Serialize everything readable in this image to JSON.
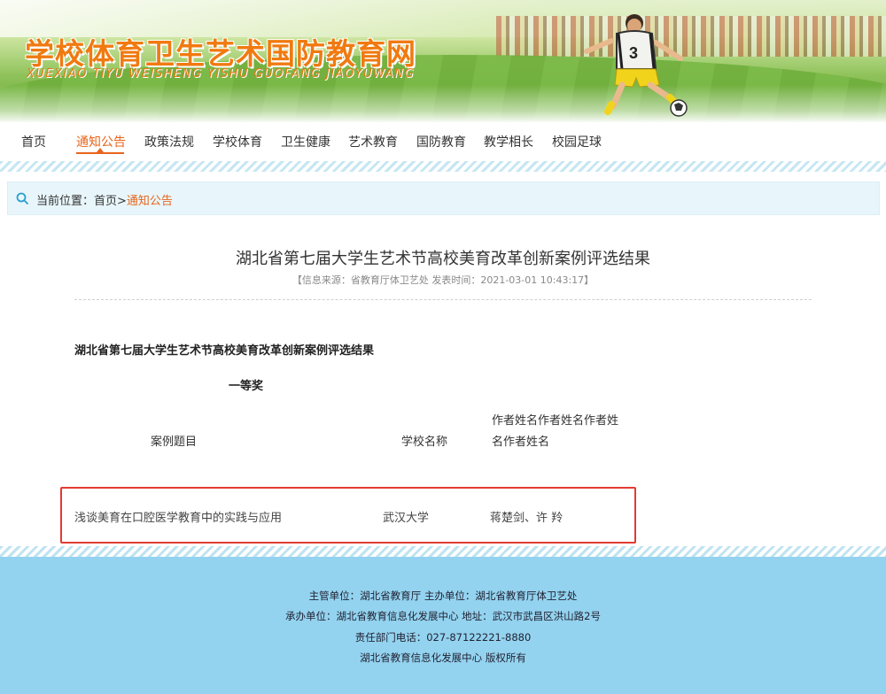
{
  "banner": {
    "title_cn": "学校体育卫生艺术国防教育网",
    "title_en": "XUEXIAO TIYU WEISHENG YISHU GUOFANG JIAOYUWANG",
    "jersey_number": "3"
  },
  "nav": {
    "items": [
      {
        "label": "首页"
      },
      {
        "label": "通知公告",
        "active": true
      },
      {
        "label": "政策法规"
      },
      {
        "label": "学校体育"
      },
      {
        "label": "卫生健康"
      },
      {
        "label": "艺术教育"
      },
      {
        "label": "国防教育"
      },
      {
        "label": "教学相长"
      },
      {
        "label": "校园足球"
      }
    ]
  },
  "breadcrumb": {
    "prefix": "当前位置：首页>",
    "current": "通知公告"
  },
  "article": {
    "title": "湖北省第七届大学生艺术节高校美育改革创新案例评选结果",
    "meta": "【信息来源：省教育厅体卫艺处 发表时间：2021-03-01 10:43:17】",
    "body_heading": "湖北省第七届大学生艺术节高校美育改革创新案例评选结果",
    "award": "一等奖",
    "table": {
      "headers": {
        "case": "案例题目",
        "school": "学校名称",
        "author": "作者姓名作者姓名作者姓名作者姓名"
      },
      "rows": [
        {
          "case": "浅谈美育在口腔医学教育中的实践与应用",
          "school": "武汉大学",
          "author": "蒋楚剑、许  羚"
        }
      ]
    }
  },
  "footer": {
    "lines": [
      "主管单位：湖北省教育厅 主办单位：湖北省教育厅体卫艺处",
      "承办单位：湖北省教育信息化发展中心 地址：武汉市武昌区洪山路2号",
      "责任部门电话：027-87122221-8880",
      "湖北省教育信息化发展中心 版权所有"
    ]
  },
  "colors": {
    "accent": "#e8651c",
    "footer_bg": "#93d3ef",
    "breadcrumb_bg": "#e8f6fb",
    "highlight_box": "#e23b32"
  }
}
